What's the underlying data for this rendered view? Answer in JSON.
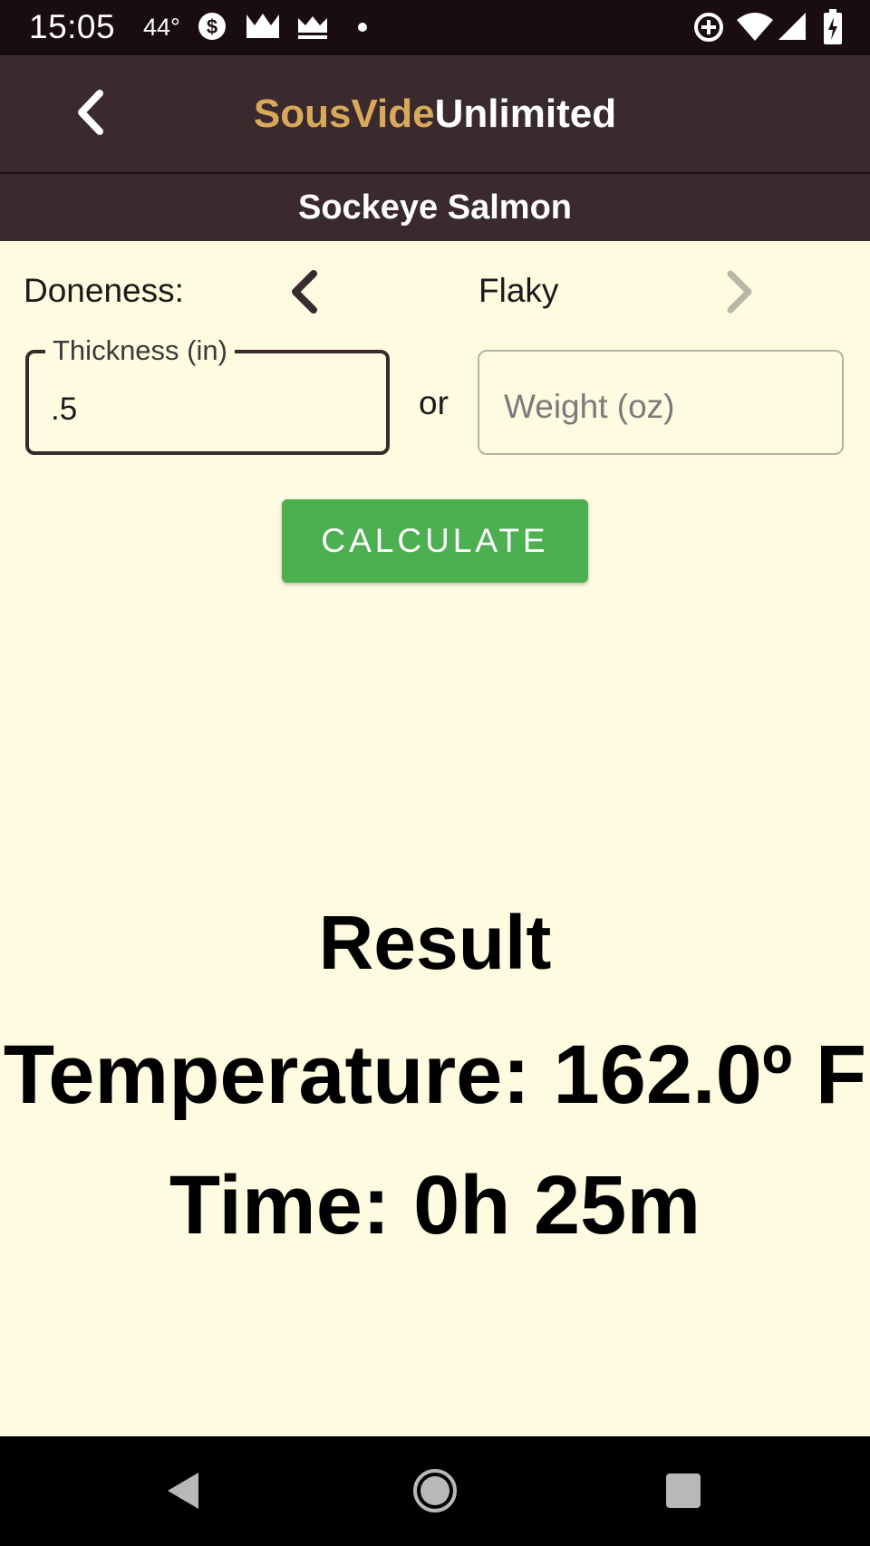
{
  "status_bar": {
    "time": "15:05",
    "temperature": "44°",
    "icons": [
      "dollar-circle-icon",
      "crown-icon",
      "crown-icon",
      "dot-icon",
      "data-saver-icon",
      "wifi-icon",
      "signal-icon",
      "battery-charging-icon"
    ]
  },
  "app_bar": {
    "title_part1": "SousVide",
    "title_part2": "Unlimited",
    "back_icon": "chevron-left-icon"
  },
  "subheader": {
    "title": "Sockeye Salmon"
  },
  "doneness": {
    "label": "Doneness:",
    "value": "Flaky",
    "prev_icon": "chevron-left-icon",
    "next_icon": "chevron-right-icon"
  },
  "thickness": {
    "label": "Thickness (in)",
    "value": ".5"
  },
  "separator": "or",
  "weight": {
    "placeholder": "Weight (oz)",
    "value": ""
  },
  "calculate_button": "CALCULATE",
  "result": {
    "heading": "Result",
    "temperature": "Temperature: 162.0º F",
    "time": "Time: 0h 25m"
  },
  "nav_bar": {
    "icons": [
      "back-triangle-icon",
      "home-circle-icon",
      "recents-square-icon"
    ]
  },
  "colors": {
    "background": "#fefbe1",
    "app_bar": "#3a2a2e",
    "title_accent": "#d9a95b",
    "button": "#4caf50",
    "status_bar": "#1a0d0f"
  }
}
